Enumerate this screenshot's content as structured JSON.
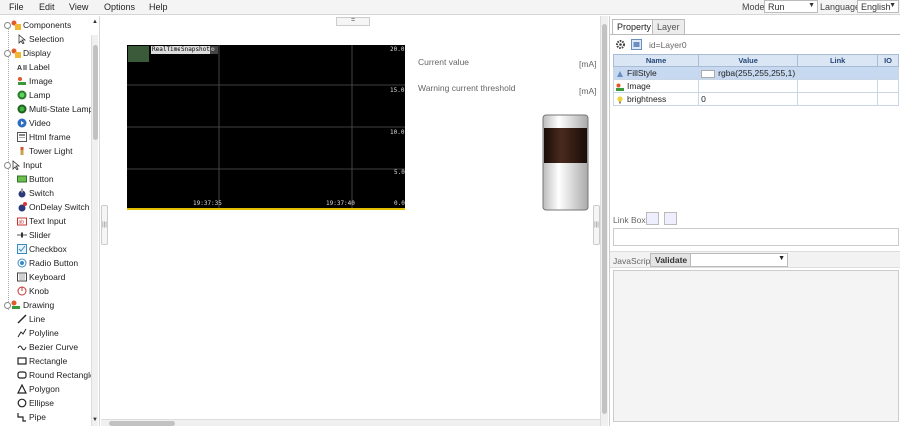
{
  "menu": {
    "items": [
      "File",
      "Edit",
      "View",
      "Options",
      "Help"
    ],
    "mode_label": "Mode:",
    "mode_value": "Run",
    "language_label": "Language:",
    "language_value": "English"
  },
  "tree": {
    "groups": [
      {
        "label": "Components",
        "items": [
          {
            "label": "Selection",
            "icon": "cursor-icon"
          }
        ]
      },
      {
        "label": "Display",
        "items": [
          {
            "label": "Label",
            "icon": "label-icon"
          },
          {
            "label": "Image",
            "icon": "image-icon"
          },
          {
            "label": "Lamp",
            "icon": "lamp-icon"
          },
          {
            "label": "Multi-State Lamp",
            "icon": "multi-state-lamp-icon"
          },
          {
            "label": "Video",
            "icon": "video-icon"
          },
          {
            "label": "Html frame",
            "icon": "html-frame-icon"
          },
          {
            "label": "Tower Light",
            "icon": "tower-light-icon"
          }
        ]
      },
      {
        "label": "Input",
        "items": [
          {
            "label": "Button",
            "icon": "button-icon"
          },
          {
            "label": "Switch",
            "icon": "switch-icon"
          },
          {
            "label": "OnDelay Switch",
            "icon": "ondelay-switch-icon"
          },
          {
            "label": "Text Input",
            "icon": "text-input-icon"
          },
          {
            "label": "Slider",
            "icon": "slider-icon"
          },
          {
            "label": "Checkbox",
            "icon": "checkbox-icon"
          },
          {
            "label": "Radio Button",
            "icon": "radio-button-icon"
          },
          {
            "label": "Keyboard",
            "icon": "keyboard-icon"
          },
          {
            "label": "Knob",
            "icon": "knob-icon"
          }
        ]
      },
      {
        "label": "Drawing",
        "items": [
          {
            "label": "Line",
            "icon": "line-icon"
          },
          {
            "label": "Polyline",
            "icon": "polyline-icon"
          },
          {
            "label": "Bezier Curve",
            "icon": "bezier-curve-icon"
          },
          {
            "label": "Rectangle",
            "icon": "rectangle-icon"
          },
          {
            "label": "Round Rectangle",
            "icon": "round-rectangle-icon"
          },
          {
            "label": "Polygon",
            "icon": "polygon-icon"
          },
          {
            "label": "Ellipse",
            "icon": "ellipse-icon"
          },
          {
            "label": "Pipe",
            "icon": "pipe-icon"
          }
        ]
      }
    ]
  },
  "canvas": {
    "chart": {
      "buttons": [
        "RealTime",
        "Snapshot"
      ],
      "y_ticks": [
        "20.0",
        "15.0",
        "10.0",
        "5.0",
        "0.0"
      ],
      "x_ticks": [
        "19:37:35",
        "19:37:40"
      ]
    },
    "current_value_label": "Current value",
    "current_value_unit": "[mA]",
    "warning_label": "Warning current threshold",
    "warning_unit": "[mA]"
  },
  "properties": {
    "tabs": [
      "Property",
      "Layer"
    ],
    "id_text": "id=Layer0",
    "columns": [
      "Name",
      "Value",
      "Link",
      "IO"
    ],
    "rows": [
      {
        "name": "FillStyle",
        "value": "rgba(255,255,255,1)",
        "icon": "fill-style-icon"
      },
      {
        "name": "Image",
        "value": "",
        "icon": "image-icon"
      },
      {
        "name": "brightness",
        "value": "0",
        "icon": "bulb-icon"
      }
    ],
    "link_box_label": "Link Box:",
    "javascript_label": "JavaScript",
    "validate_label": "Validate"
  }
}
